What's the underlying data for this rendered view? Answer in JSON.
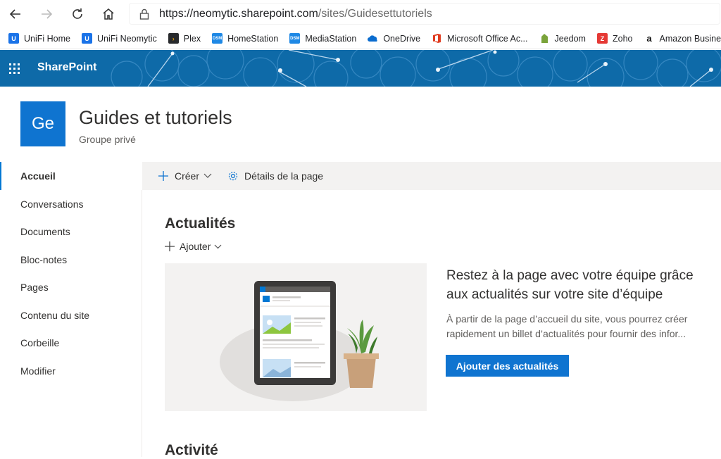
{
  "browser": {
    "url_host": "https://neomytic.sharepoint.com",
    "url_path": "/sites/Guidesettutoriels"
  },
  "bookmarks": [
    {
      "label": "UniFi Home",
      "icon": "unifi-icon",
      "color": "#1a73e8"
    },
    {
      "label": "UniFi Neomytic",
      "icon": "unifi-icon",
      "color": "#1a73e8"
    },
    {
      "label": "Plex",
      "icon": "plex-icon",
      "color": "#282a2d"
    },
    {
      "label": "HomeStation",
      "icon": "dsm-icon",
      "color": "#1e88e5"
    },
    {
      "label": "MediaStation",
      "icon": "dsm-icon",
      "color": "#1e88e5"
    },
    {
      "label": "OneDrive",
      "icon": "onedrive-icon",
      "color": "#0a6ccf"
    },
    {
      "label": "Microsoft Office Ac...",
      "icon": "office-icon",
      "color": "#e03b1f"
    },
    {
      "label": "Jeedom",
      "icon": "jeedom-icon",
      "color": "#7aa33a"
    },
    {
      "label": "Zoho",
      "icon": "zoho-icon",
      "color": "#e53935"
    },
    {
      "label": "Amazon Business",
      "icon": "amazon-icon",
      "color": "#111111"
    }
  ],
  "suitebar": {
    "title": "SharePoint",
    "color": "#0e6aa8"
  },
  "site": {
    "logo_text": "Ge",
    "title": "Guides et tutoriels",
    "subtitle": "Groupe privé"
  },
  "nav": [
    {
      "label": "Accueil",
      "active": true
    },
    {
      "label": "Conversations"
    },
    {
      "label": "Documents"
    },
    {
      "label": "Bloc-notes"
    },
    {
      "label": "Pages"
    },
    {
      "label": "Contenu du site"
    },
    {
      "label": "Corbeille"
    },
    {
      "label": "Modifier"
    }
  ],
  "commandbar": {
    "create": "Créer",
    "page_details": "Détails de la page"
  },
  "news": {
    "title": "Actualités",
    "add": "Ajouter",
    "promo_title": "Restez à la page avec votre équipe grâce aux actualités sur votre site d’équipe",
    "promo_text": "À partir de la page d’accueil du site, vous pourrez créer rapidement un billet d’actualités pour fournir des infor...",
    "button": "Ajouter des actualités"
  },
  "activity": {
    "title": "Activité"
  },
  "colors": {
    "accent": "#0f74d0"
  }
}
